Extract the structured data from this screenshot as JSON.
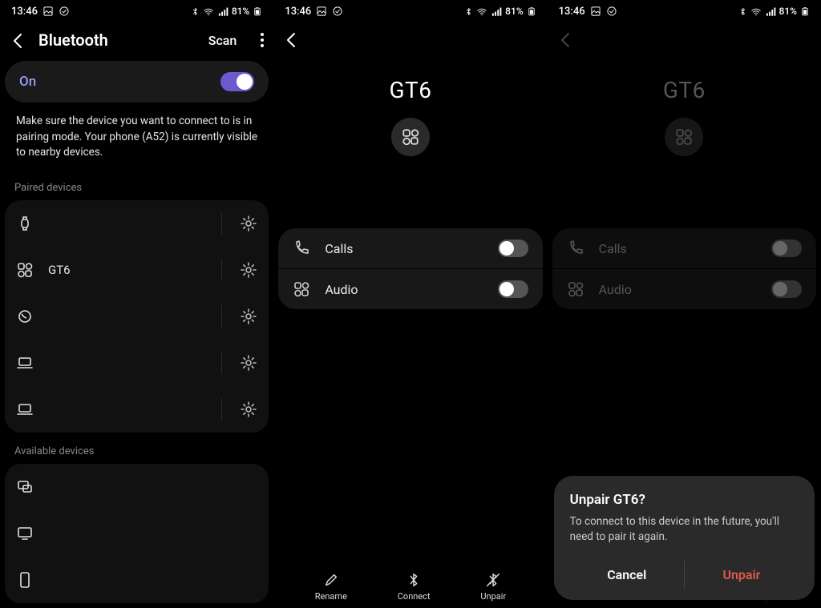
{
  "status": {
    "time": "13:46",
    "battery_pct": "81%"
  },
  "screen1": {
    "title": "Bluetooth",
    "scan": "Scan",
    "on_label": "On",
    "help": "Make sure the device you want to connect to is in pairing mode. Your phone (A52) is currently visible to nearby devices.",
    "paired_header": "Paired devices",
    "available_header": "Available devices",
    "paired": [
      {
        "icon": "watch",
        "name": ""
      },
      {
        "icon": "grid",
        "name": "GT6"
      },
      {
        "icon": "circle",
        "name": ""
      },
      {
        "icon": "laptop",
        "name": ""
      },
      {
        "icon": "laptop",
        "name": ""
      }
    ],
    "available": [
      {
        "icon": "displays"
      },
      {
        "icon": "monitor"
      },
      {
        "icon": "phone"
      }
    ]
  },
  "screen2": {
    "device_name": "GT6",
    "options": [
      {
        "icon": "phone-call",
        "label": "Calls",
        "on": true
      },
      {
        "icon": "grid",
        "label": "Audio",
        "on": true
      }
    ],
    "actions": {
      "rename": "Rename",
      "connect": "Connect",
      "unpair": "Unpair"
    }
  },
  "screen3": {
    "device_name": "GT6",
    "options": [
      {
        "icon": "phone-call",
        "label": "Calls",
        "on": true
      },
      {
        "icon": "grid",
        "label": "Audio",
        "on": true
      }
    ],
    "dialog": {
      "title": "Unpair GT6?",
      "message": "To connect to this device in the future, you'll need to pair it again.",
      "cancel": "Cancel",
      "confirm": "Unpair"
    }
  }
}
